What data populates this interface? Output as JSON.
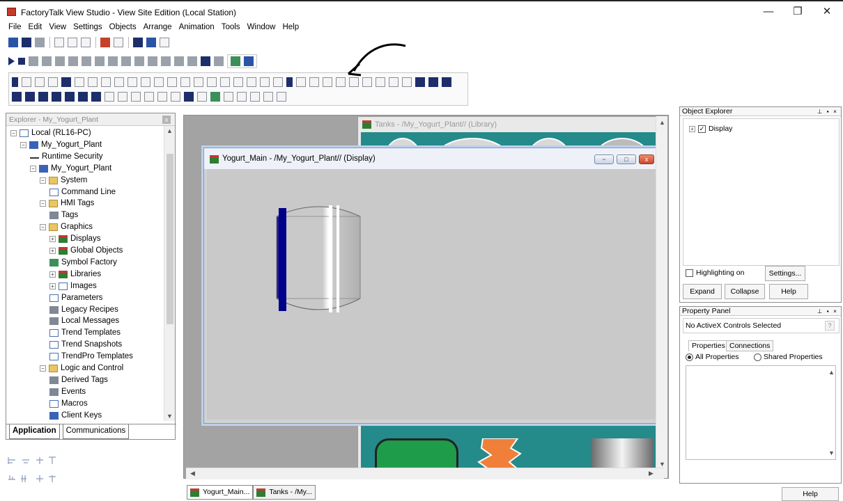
{
  "window": {
    "title": "FactoryTalk View Studio - View Site Edition (Local Station)",
    "minimize": "—",
    "restore": "❐",
    "close": "✕"
  },
  "menu": [
    "File",
    "Edit",
    "View",
    "Settings",
    "Objects",
    "Arrange",
    "Animation",
    "Tools",
    "Window",
    "Help"
  ],
  "explorer": {
    "title": "Explorer - My_Yogurt_Plant",
    "tree": [
      {
        "label": "Local (RL16-PC)",
        "indent": 0,
        "exp": "−",
        "icon": "page"
      },
      {
        "label": "My_Yogurt_Plant",
        "indent": 1,
        "exp": "−",
        "icon": "blue"
      },
      {
        "label": "Runtime Security",
        "indent": 2,
        "exp": "",
        "icon": "key"
      },
      {
        "label": "My_Yogurt_Plant",
        "indent": 2,
        "exp": "−",
        "icon": "blue"
      },
      {
        "label": "System",
        "indent": 3,
        "exp": "−",
        "icon": "folder"
      },
      {
        "label": "Command Line",
        "indent": 4,
        "exp": "",
        "icon": "page"
      },
      {
        "label": "HMI Tags",
        "indent": 3,
        "exp": "−",
        "icon": "folder"
      },
      {
        "label": "Tags",
        "indent": 4,
        "exp": "",
        "icon": "gray"
      },
      {
        "label": "Graphics",
        "indent": 3,
        "exp": "−",
        "icon": "folder"
      },
      {
        "label": "Displays",
        "indent": 4,
        "exp": "+",
        "icon": "dispic"
      },
      {
        "label": "Global Objects",
        "indent": 4,
        "exp": "+",
        "icon": "dispic"
      },
      {
        "label": "Symbol Factory",
        "indent": 4,
        "exp": "",
        "icon": "green"
      },
      {
        "label": "Libraries",
        "indent": 4,
        "exp": "+",
        "icon": "dispic"
      },
      {
        "label": "Images",
        "indent": 4,
        "exp": "+",
        "icon": "page"
      },
      {
        "label": "Parameters",
        "indent": 4,
        "exp": "",
        "icon": "page"
      },
      {
        "label": "Legacy Recipes",
        "indent": 4,
        "exp": "",
        "icon": "gray"
      },
      {
        "label": "Local Messages",
        "indent": 4,
        "exp": "",
        "icon": "gray"
      },
      {
        "label": "Trend Templates",
        "indent": 4,
        "exp": "",
        "icon": "page"
      },
      {
        "label": "Trend Snapshots",
        "indent": 4,
        "exp": "",
        "icon": "page"
      },
      {
        "label": "TrendPro Templates",
        "indent": 4,
        "exp": "",
        "icon": "page"
      },
      {
        "label": "Logic and Control",
        "indent": 3,
        "exp": "−",
        "icon": "folder"
      },
      {
        "label": "Derived Tags",
        "indent": 4,
        "exp": "",
        "icon": "gray"
      },
      {
        "label": "Events",
        "indent": 4,
        "exp": "",
        "icon": "gray"
      },
      {
        "label": "Macros",
        "indent": 4,
        "exp": "",
        "icon": "page"
      },
      {
        "label": "Client Keys",
        "indent": 4,
        "exp": "",
        "icon": "blue"
      }
    ],
    "tabs": {
      "application": "Application",
      "communications": "Communications"
    }
  },
  "tanks_window": {
    "title": "Tanks - /My_Yogurt_Plant// (Library)"
  },
  "yogurt_main": {
    "title": "Yogurt_Main - /My_Yogurt_Plant// (Display)"
  },
  "doc_tabs": {
    "yogurt": "Yogurt_Main...",
    "tanks": "Tanks - /My..."
  },
  "object_explorer": {
    "title": "Object Explorer",
    "item": "Display",
    "highlighting": "Highlighting on",
    "settings": "Settings...",
    "expand": "Expand",
    "collapse": "Collapse",
    "help": "Help"
  },
  "property_panel": {
    "title": "Property Panel",
    "selection": "No ActiveX Controls Selected",
    "qmark": "?",
    "tab_properties": "Properties",
    "tab_connections": "Connections",
    "all_props": "All Properties",
    "shared_props": "Shared Properties",
    "help": "Help"
  },
  "colors": {
    "tank_blue": "#00008b",
    "tank_gray": "#c9c9c9",
    "teal": "#258a8a",
    "orange": "#f07f3a"
  }
}
